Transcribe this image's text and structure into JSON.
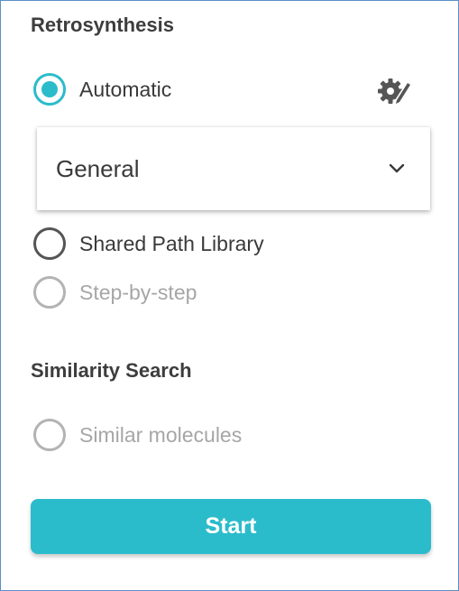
{
  "retrosynthesis": {
    "title": "Retrosynthesis",
    "options": {
      "automatic": "Automatic",
      "shared_path_library": "Shared Path Library",
      "step_by_step": "Step-by-step"
    },
    "selected_option": "automatic",
    "settings_icon": "gear-pencil-icon",
    "algorithm_select": {
      "value": "General",
      "icon": "chevron-down-icon"
    }
  },
  "similarity_search": {
    "title": "Similarity Search",
    "options": {
      "similar_molecules": "Similar molecules"
    }
  },
  "start_button": {
    "label": "Start"
  },
  "colors": {
    "accent": "#2bbccb",
    "text": "#3a3a3a",
    "disabled_text": "#a6a6a6",
    "border": "#5b8fc7"
  }
}
